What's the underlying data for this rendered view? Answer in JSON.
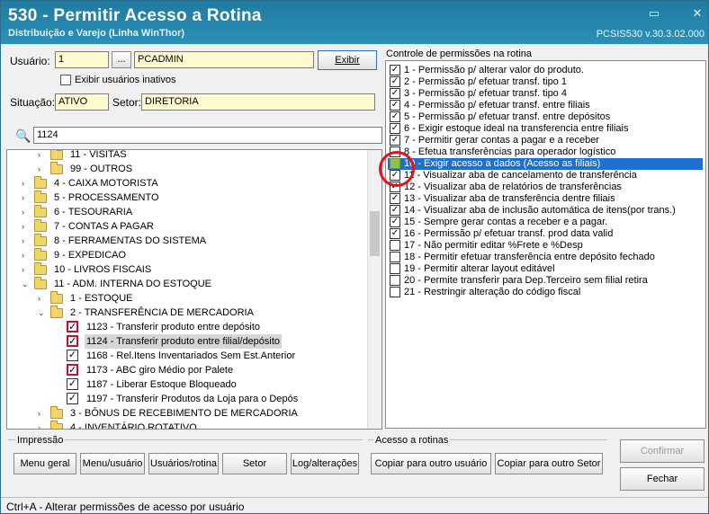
{
  "window": {
    "title": "530 - Permitir Acesso a Rotina",
    "subtitle": "Distribuição e Varejo (Linha WinThor)",
    "version": "PCSIS530  v.30.3.02.000",
    "minimize_glyph": "▭",
    "close_glyph": "✕"
  },
  "form": {
    "usuario_label": "Usuário:",
    "usuario_code": "1",
    "lookup_label": "...",
    "usuario_name": "PCADMIN",
    "exibir_label": "Exibir",
    "exibir_inativos_label": "Exibir usuários inativos",
    "situacao_label": "Situação:",
    "situacao_value": "ATIVO",
    "setor_label": "Setor:",
    "setor_value": "DIRETORIA",
    "search_value": "1124"
  },
  "tree": [
    {
      "indent": 2,
      "chev": "›",
      "type": "folder",
      "label": "11 - VISITAS"
    },
    {
      "indent": 2,
      "chev": "›",
      "type": "folder",
      "label": "99 - OUTROS"
    },
    {
      "indent": 1,
      "chev": "›",
      "type": "folder",
      "label": "4 - CAIXA MOTORISTA"
    },
    {
      "indent": 1,
      "chev": "›",
      "type": "folder",
      "label": "5 - PROCESSAMENTO"
    },
    {
      "indent": 1,
      "chev": "›",
      "type": "folder",
      "label": "6 - TESOURARIA"
    },
    {
      "indent": 1,
      "chev": "›",
      "type": "folder",
      "label": "7 - CONTAS A PAGAR"
    },
    {
      "indent": 1,
      "chev": "›",
      "type": "folder",
      "label": "8 - FERRAMENTAS DO SISTEMA"
    },
    {
      "indent": 1,
      "chev": "›",
      "type": "folder",
      "label": "9 - EXPEDICAO"
    },
    {
      "indent": 1,
      "chev": "›",
      "type": "folder",
      "label": "10 - LIVROS FISCAIS"
    },
    {
      "indent": 1,
      "chev": "⌄",
      "type": "folder",
      "label": "11 - ADM. INTERNA DO ESTOQUE"
    },
    {
      "indent": 2,
      "chev": "›",
      "type": "folder",
      "label": "1 - ESTOQUE"
    },
    {
      "indent": 2,
      "chev": "⌄",
      "type": "folder",
      "label": "2 - TRANSFERÊNCIA DE MERCADORIA"
    },
    {
      "indent": 3,
      "chev": "",
      "type": "check",
      "checked": true,
      "red": true,
      "label": "1123 - Transferir produto entre depósito"
    },
    {
      "indent": 3,
      "chev": "",
      "type": "check",
      "checked": true,
      "red": true,
      "selected": true,
      "label": "1124 - Transferir produto entre filial/depósito"
    },
    {
      "indent": 3,
      "chev": "",
      "type": "check",
      "checked": true,
      "red": false,
      "label": "1168 - Rel.Itens Inventariados Sem Est.Anterior"
    },
    {
      "indent": 3,
      "chev": "",
      "type": "check",
      "checked": true,
      "red": true,
      "label": "1173 - ABC giro Médio por Palete"
    },
    {
      "indent": 3,
      "chev": "",
      "type": "check",
      "checked": true,
      "red": false,
      "label": "1187 - Liberar Estoque Bloqueado"
    },
    {
      "indent": 3,
      "chev": "",
      "type": "check",
      "checked": true,
      "red": false,
      "label": "1197 - Transferir Produtos da Loja para o Depós"
    },
    {
      "indent": 2,
      "chev": "›",
      "type": "folder",
      "label": "3 - BÔNUS DE RECEBIMENTO DE MERCADORIA"
    },
    {
      "indent": 2,
      "chev": "›",
      "type": "folder",
      "label": "4 - INVENTÁRIO ROTATIVO"
    }
  ],
  "permissions": {
    "title": "Controle de permissões na rotina",
    "items": [
      {
        "label": "1 - Permissão p/ alterar valor do produto.",
        "checked": true
      },
      {
        "label": "2 - Permissão p/ efetuar transf. tipo 1",
        "checked": true
      },
      {
        "label": "3 - Permissão p/ efetuar transf. tipo 4",
        "checked": true
      },
      {
        "label": "4 - Permissão p/ efetuar transf. entre filiais",
        "checked": true
      },
      {
        "label": "5 - Permissão p/ efetuar transf. entre depósitos",
        "checked": true
      },
      {
        "label": "6 - Exigir estoque ideal na transferencia entre filiais",
        "checked": true
      },
      {
        "label": "7 - Permitir gerar contas a pagar e a receber",
        "checked": true
      },
      {
        "label": "8 - Efetua transferências para operador logístico",
        "checked": false
      },
      {
        "label": "10 - Exigir acesso a dados (Acesso as filiais)",
        "checked": false,
        "selected": true
      },
      {
        "label": "11 - Visualizar aba de cancelamento de transferência",
        "checked": true
      },
      {
        "label": "12 - Visualizar aba de relatórios de transferências",
        "checked": true
      },
      {
        "label": "13 - Visualizar aba de transferência dentre filiais",
        "checked": true
      },
      {
        "label": "14 - Visualizar aba de inclusão automática de itens(por trans.)",
        "checked": true
      },
      {
        "label": "15 - Sempre gerar contas a receber e a pagar.",
        "checked": true
      },
      {
        "label": "16 - Permissão p/ efetuar transf. prod data valid",
        "checked": true
      },
      {
        "label": "17 - Não permitir editar %Frete e %Desp",
        "checked": false
      },
      {
        "label": "18 - Permitir efetuar transferência entre depósito fechado",
        "checked": false
      },
      {
        "label": "19 - Permitir alterar layout editável",
        "checked": false
      },
      {
        "label": "20 - Permite transferir para Dep.Terceiro sem filial retira",
        "checked": false
      },
      {
        "label": "21 - Restringir alteração do código fiscal",
        "checked": false
      }
    ]
  },
  "impressao": {
    "title": "Impressão",
    "menu_geral": "Menu geral",
    "menu_usuario": "Menu/usuário",
    "usuarios_rotina": "Usuários/rotina",
    "setor": "Setor",
    "log_alteracoes": "Log/alterações"
  },
  "acesso": {
    "title": "Acesso a rotinas",
    "copiar_usuario": "Copiar para outro usuário",
    "copiar_setor": "Copiar para outro Setor"
  },
  "actions": {
    "confirmar": "Confirmar",
    "fechar": "Fechar"
  },
  "status": "Ctrl+A - Alterar permissões de acesso por usuário"
}
